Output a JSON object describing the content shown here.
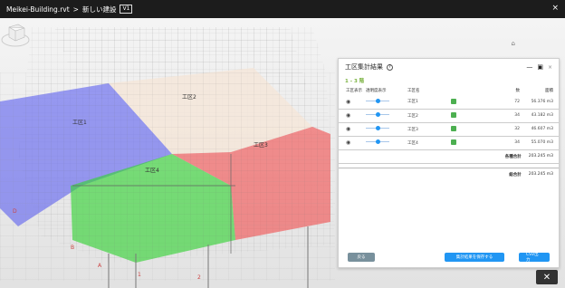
{
  "titlebar": {
    "project": "Meikei-Building.rvt",
    "separator": ">",
    "model": "新しい建設",
    "version": "V1",
    "close": "×"
  },
  "viewport": {
    "zones": [
      {
        "label": "工区1",
        "color": "#5a5ef0"
      },
      {
        "label": "工区2",
        "color": "#f5e6d8"
      },
      {
        "label": "工区3",
        "color": "#f24b4b"
      },
      {
        "label": "工区4",
        "color": "#38d338"
      }
    ],
    "grid_markers": [
      "D",
      "B",
      "A",
      "1",
      "2"
    ],
    "compass": "⌂",
    "tool_button": "✕"
  },
  "panel": {
    "title": "工区集計結果",
    "help": "?",
    "minimize": "—",
    "expand": "▣",
    "close": "×",
    "floor": "1 - 3 階",
    "columns": [
      "工区表示",
      "透明度表示",
      "工区名",
      "",
      "数",
      "面積"
    ],
    "rows": [
      {
        "name": "工区1",
        "count": "72",
        "area": "56.376 m3"
      },
      {
        "name": "工区2",
        "count": "34",
        "area": "43.182 m3"
      },
      {
        "name": "工区3",
        "count": "32",
        "area": "46.607 m3"
      },
      {
        "name": "工区4",
        "count": "34",
        "area": "55.070 m3"
      }
    ],
    "subtotal_label": "各種合計",
    "subtotal_value": "203.245 m3",
    "total_label": "総合計",
    "total_value": "203.245 m3",
    "buttons": {
      "back": "戻る",
      "save": "集計結果を保存する",
      "csv": "CSV出力"
    }
  }
}
